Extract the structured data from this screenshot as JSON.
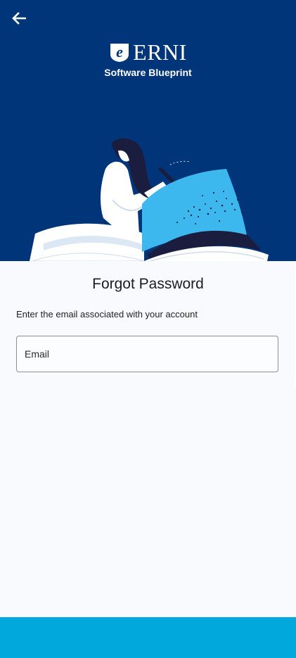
{
  "header": {
    "back_icon": "arrow-left-icon",
    "logo_text": "ERNI",
    "logo_subtitle": "Software Blueprint"
  },
  "form": {
    "title": "Forgot Password",
    "instruction": "Enter the email associated with your account",
    "email_placeholder": "Email",
    "email_value": ""
  },
  "action": {
    "label": ""
  },
  "colors": {
    "hero_bg": "#00357a",
    "page_bg": "#f8fafd",
    "action_bg": "#00a8dc",
    "accent_light_blue": "#3cb8ef"
  }
}
